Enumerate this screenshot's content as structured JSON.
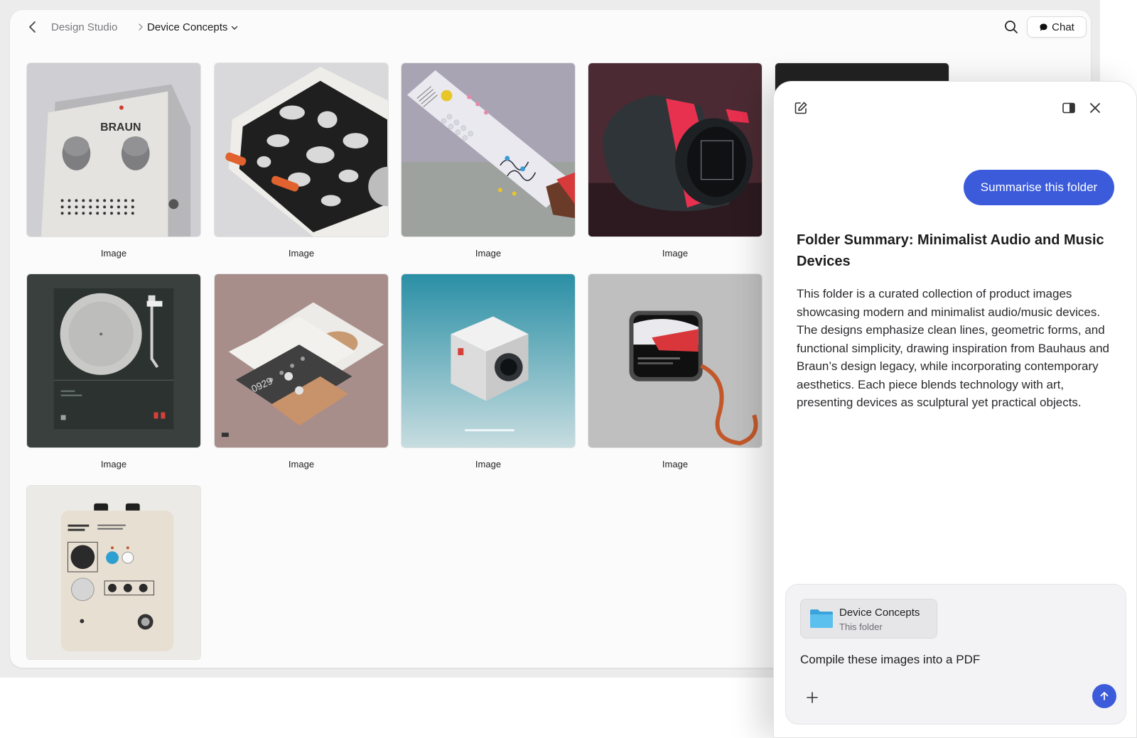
{
  "breadcrumb": {
    "parent": "Design Studio",
    "current": "Device Concepts"
  },
  "header": {
    "chat_label": "Chat"
  },
  "icons": {
    "back": "chevron-left-icon",
    "separator": "chevron-right-icon",
    "dropdown": "chevron-down-icon",
    "search": "search-icon",
    "chat": "chat-bubble-icon",
    "new_chat": "edit-icon",
    "sidebar_toggle": "sidebar-icon",
    "close": "close-icon",
    "folder": "folder-icon",
    "add": "plus-icon",
    "send": "arrow-up-icon"
  },
  "gallery": {
    "items": [
      {
        "label": "Image"
      },
      {
        "label": "Image"
      },
      {
        "label": "Image"
      },
      {
        "label": "Image"
      },
      {
        "label": "Image"
      },
      {
        "label": "Image"
      },
      {
        "label": "Image"
      },
      {
        "label": "Image"
      },
      {
        "label": "Image"
      }
    ]
  },
  "chat": {
    "user_message": "Summarise this folder",
    "response_title": "Folder Summary: Minimalist Audio and Music Devices",
    "response_body": "This folder is a curated collection of product images showcasing modern and minimalist audio/music devices. The designs emphasize clean lines, geometric forms, and functional simplicity, drawing inspiration from Bauhaus and Braun’s design legacy, while incorporating contemporary aesthetics. Each piece blends technology with art, presenting devices as sculptural yet practical objects.",
    "attachment": {
      "name": "Device Concepts",
      "subtitle": "This folder"
    },
    "input_value": "Compile these images into a PDF"
  },
  "colors": {
    "accent": "#3b5bdb",
    "folder": "#4fb3e8"
  }
}
